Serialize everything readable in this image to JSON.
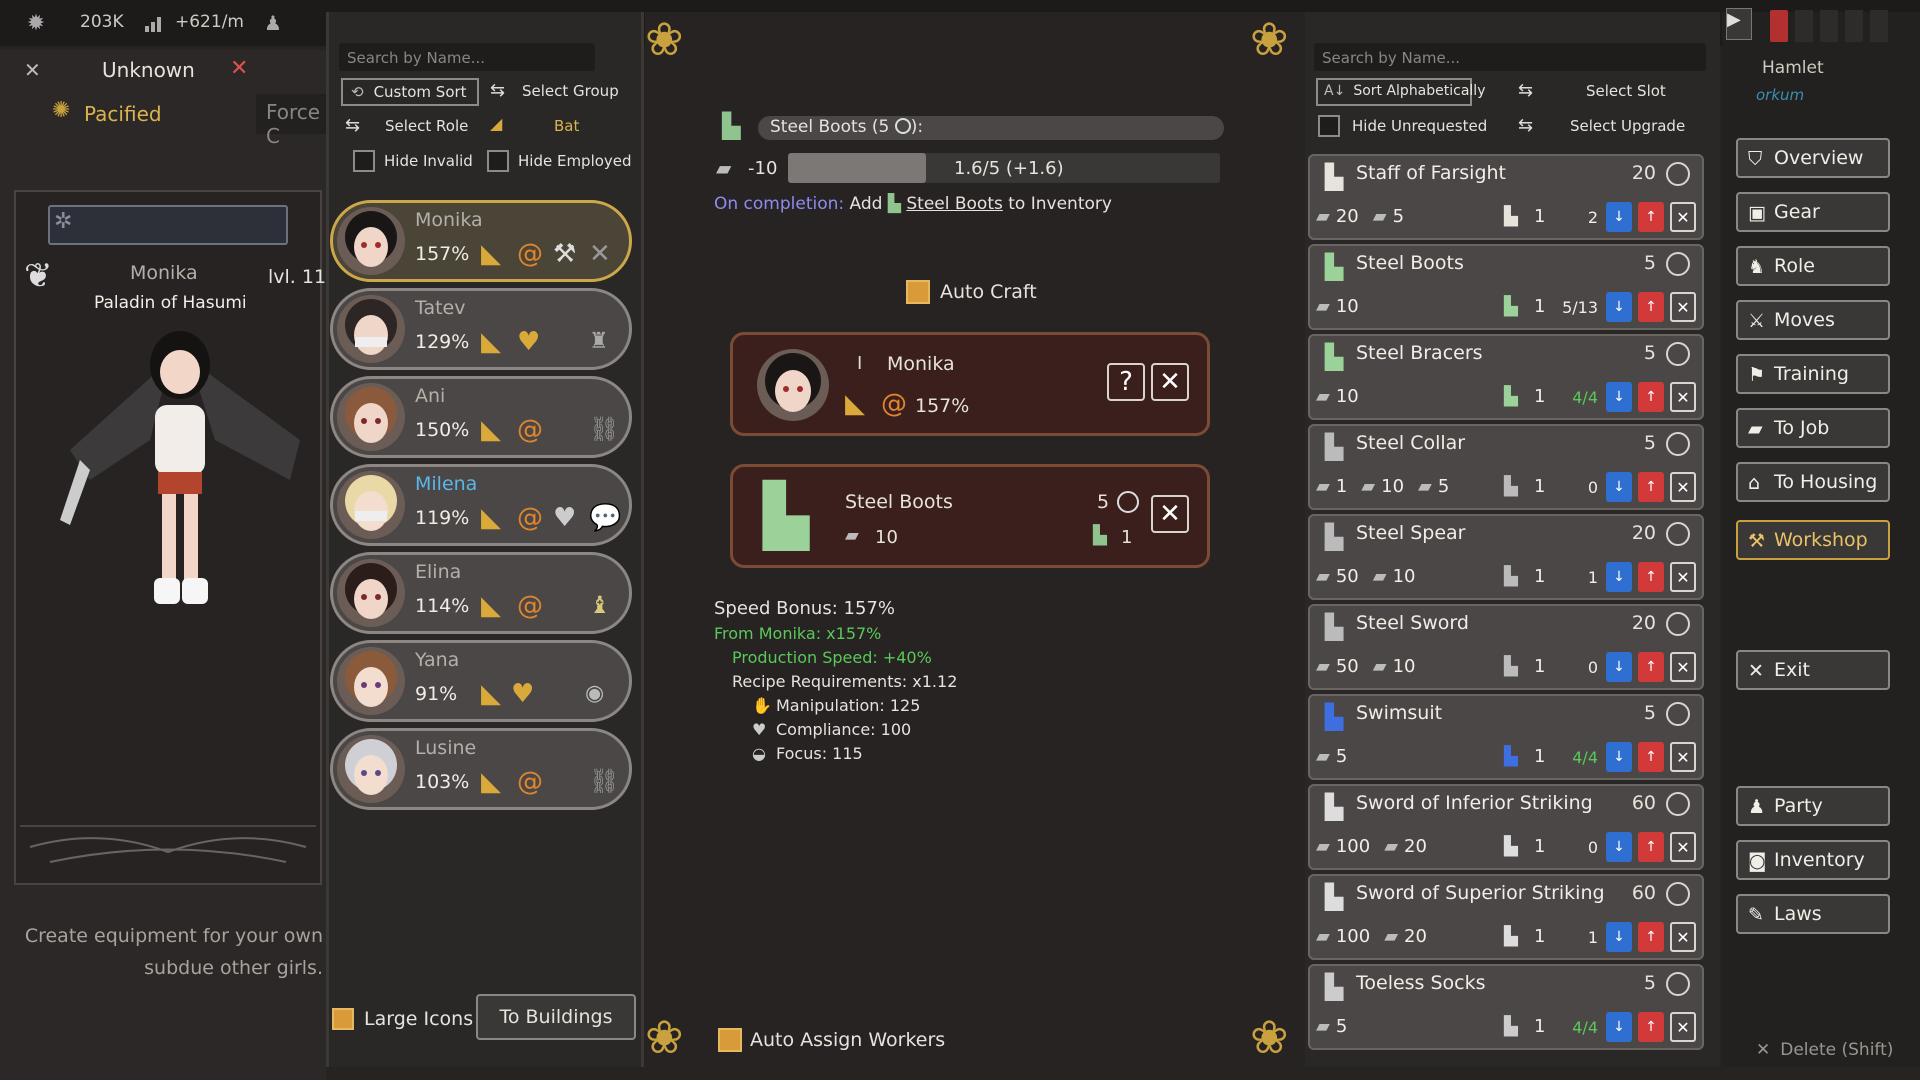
{
  "topbar": {
    "money": "203K",
    "rate": "+621/m"
  },
  "status": {
    "name": "Unknown",
    "state": "Pacified",
    "force_label": "Force C"
  },
  "character": {
    "name": "Monika",
    "level": "lvl. 11",
    "title": "Paladin of Hasumi"
  },
  "description": "Create equipment for your own army or subdue other girls.",
  "description_lines": [
    "Create equipment for your own",
    "subdue other girls."
  ],
  "workers_panel": {
    "search_placeholder": "Search by Name...",
    "custom_sort": "Custom Sort",
    "select_group": "Select Group",
    "select_role": "Select Role",
    "role_value": "Bat",
    "hide_invalid": "Hide Invalid",
    "hide_employed": "Hide Employed",
    "large_icons": "Large Icons",
    "to_buildings": "To Buildings"
  },
  "workers": [
    {
      "name": "Monika",
      "pct": "157%"
    },
    {
      "name": "Tatev",
      "pct": "129%"
    },
    {
      "name": "Ani",
      "pct": "150%"
    },
    {
      "name": "Milena",
      "pct": "119%"
    },
    {
      "name": "Elina",
      "pct": "114%"
    },
    {
      "name": "Yana",
      "pct": "91%"
    },
    {
      "name": "Lusine",
      "pct": "103%"
    }
  ],
  "job": {
    "title": "Steel Boots (5 ",
    "title_suffix": "):",
    "cost": "-10",
    "progress_text": "1.6/5 (+1.6)",
    "progress_fraction": 0.32,
    "completion_prefix": "On completion:",
    "completion_add": "Add",
    "completion_item": "Steel Boots",
    "completion_suffix": "to Inventory",
    "auto_craft": "Auto Craft",
    "worker_name": "Monika",
    "worker_pct": "157%",
    "worker_rank": "I",
    "recipe_name": "Steel Boots",
    "recipe_time": "5",
    "recipe_cost": "10",
    "recipe_out": "1",
    "speed_bonus": "Speed Bonus: 157%",
    "from_worker": "From Monika: x157%",
    "production_speed": "Production Speed: +40%",
    "recipe_req": "Recipe Requirements: x1.12",
    "manipulation": "Manipulation: 125",
    "compliance": "Compliance: 100",
    "focus": "Focus: 115",
    "auto_assign": "Auto Assign Workers"
  },
  "recipes_panel": {
    "search_placeholder": "Search by Name...",
    "sort": "Sort Alphabetically",
    "select_slot": "Select Slot",
    "hide_unrequested": "Hide Unrequested",
    "select_upgrade": "Select Upgrade"
  },
  "recipes": [
    {
      "name": "Staff of Farsight",
      "time": "20",
      "r1": "20",
      "r2": "5",
      "out": "1",
      "prog": "2"
    },
    {
      "name": "Steel Boots",
      "time": "5",
      "r1": "10",
      "r2": "",
      "out": "1",
      "prog": "5/13"
    },
    {
      "name": "Steel Bracers",
      "time": "5",
      "r1": "10",
      "r2": "",
      "out": "1",
      "prog": "4/4"
    },
    {
      "name": "Steel Collar",
      "time": "5",
      "r1": "1",
      "r2": "10",
      "r3": "5",
      "out": "1",
      "prog": "0"
    },
    {
      "name": "Steel Spear",
      "time": "20",
      "r1": "50",
      "r2": "10",
      "out": "1",
      "prog": "1"
    },
    {
      "name": "Steel Sword",
      "time": "20",
      "r1": "50",
      "r2": "10",
      "out": "1",
      "prog": "0"
    },
    {
      "name": "Swimsuit",
      "time": "5",
      "r1": "5",
      "r2": "",
      "out": "1",
      "prog": "4/4"
    },
    {
      "name": "Sword of Inferior Striking",
      "time": "60",
      "r1": "100",
      "r2": "20",
      "out": "1",
      "prog": "0"
    },
    {
      "name": "Sword of Superior Striking",
      "time": "60",
      "r1": "100",
      "r2": "20",
      "out": "1",
      "prog": "1"
    },
    {
      "name": "Toeless Socks",
      "time": "5",
      "r1": "5",
      "r2": "",
      "out": "1",
      "prog": "4/4"
    }
  ],
  "location": {
    "name": "Hamlet",
    "sub": "Workshop"
  },
  "location_sub_visible": "orkum",
  "nav": {
    "overview": "Overview",
    "gear": "Gear",
    "role": "Role",
    "moves": "Moves",
    "training": "Training",
    "to_job": "To Job",
    "to_housing": "To Housing",
    "workshop": "Workshop",
    "exit": "Exit",
    "party": "Party",
    "inventory": "Inventory",
    "laws": "Laws",
    "delete": "Delete (Shift)"
  },
  "colors": {
    "accent": "#c9a13e",
    "green": "#5ac85a",
    "blue": "#8d8cf0",
    "red": "#d23a3a"
  }
}
